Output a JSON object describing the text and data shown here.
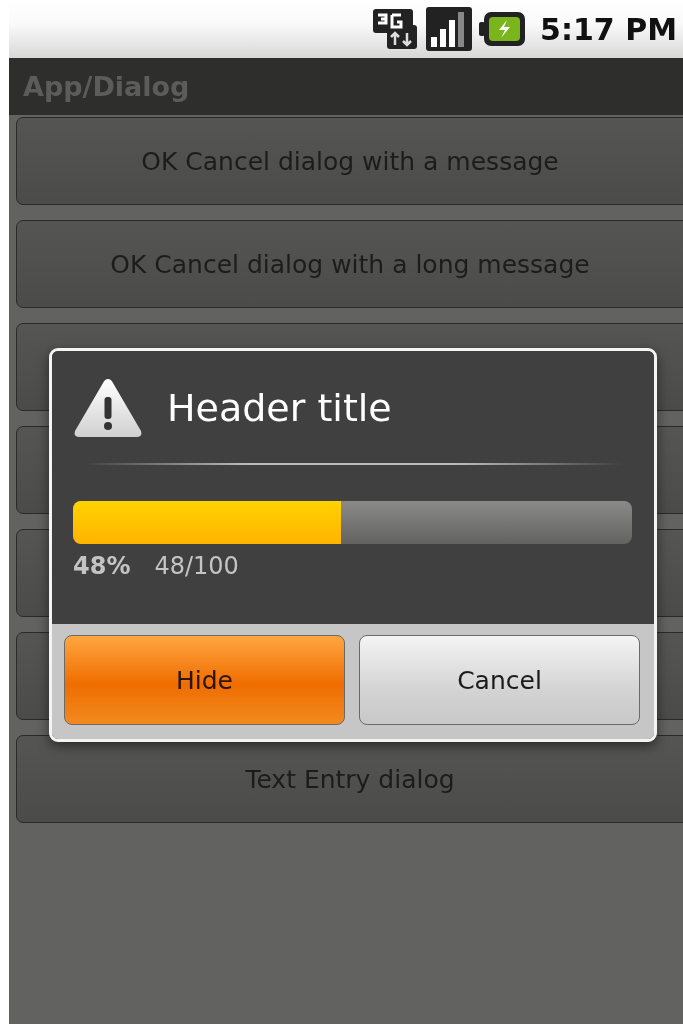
{
  "status_bar": {
    "time": "5:17 PM"
  },
  "title_bar": {
    "title": "App/Dialog"
  },
  "list_buttons": [
    {
      "label": "OK Cancel dialog with a message"
    },
    {
      "label": "OK Cancel dialog with a long message"
    },
    {
      "covered": true
    },
    {
      "covered": true
    },
    {
      "covered": true
    },
    {
      "covered": true
    },
    {
      "label": "Text Entry dialog"
    }
  ],
  "dialog": {
    "title": "Header title",
    "progress": {
      "level": 0.48,
      "percent": "48%",
      "count": "48/100"
    },
    "buttons": [
      {
        "label": "Hide",
        "focused": true
      },
      {
        "label": "Cancel",
        "focused": false
      }
    ]
  }
}
